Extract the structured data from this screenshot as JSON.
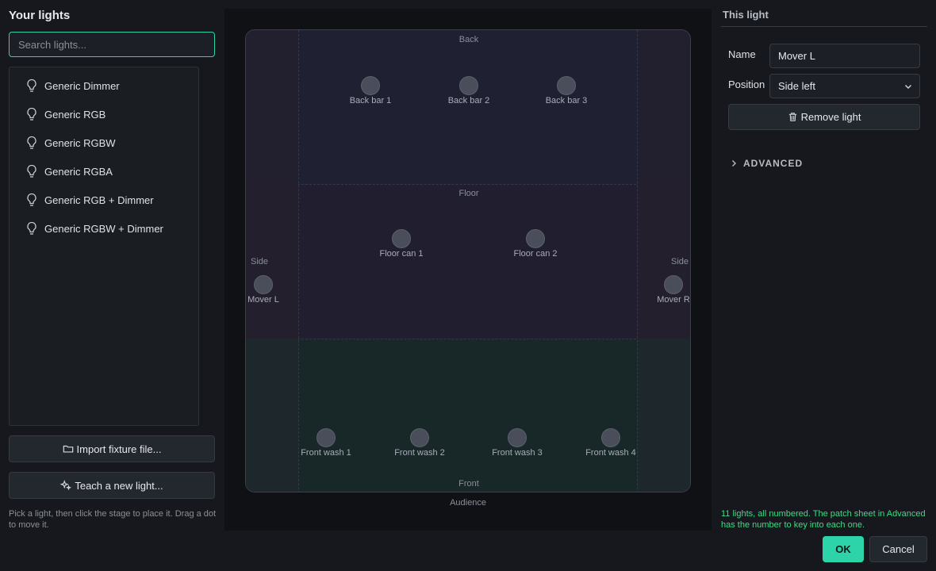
{
  "left": {
    "title": "Your lights",
    "search_placeholder": "Search lights...",
    "fixtures": [
      "Generic Dimmer",
      "Generic RGB",
      "Generic RGBW",
      "Generic RGBA",
      "Generic RGB + Dimmer",
      "Generic RGBW + Dimmer"
    ],
    "import_label": "Import fixture file...",
    "teach_label": "Teach a new light...",
    "hint": "Pick a light, then click the stage to place it. Drag a dot to move it."
  },
  "stage": {
    "zones": {
      "back": "Back",
      "floor": "Floor",
      "front": "Front",
      "side_left": "Side",
      "side_right": "Side"
    },
    "audience": "Audience",
    "lights": [
      {
        "id": "back-bar-1",
        "label": "Back bar 1"
      },
      {
        "id": "back-bar-2",
        "label": "Back bar 2"
      },
      {
        "id": "back-bar-3",
        "label": "Back bar 3"
      },
      {
        "id": "floor-can-1",
        "label": "Floor can 1"
      },
      {
        "id": "floor-can-2",
        "label": "Floor can 2"
      },
      {
        "id": "mover-l",
        "label": "Mover L"
      },
      {
        "id": "mover-r",
        "label": "Mover R"
      },
      {
        "id": "front-wash-1",
        "label": "Front wash 1"
      },
      {
        "id": "front-wash-2",
        "label": "Front wash 2"
      },
      {
        "id": "front-wash-3",
        "label": "Front wash 3"
      },
      {
        "id": "front-wash-4",
        "label": "Front wash 4"
      }
    ]
  },
  "right": {
    "title": "This light",
    "name_label": "Name",
    "name_value": "Mover L",
    "position_label": "Position",
    "position_value": "Side left",
    "remove_label": "Remove light",
    "advanced_label": "ADVANCED",
    "status": "11 lights, all numbered. The patch sheet in Advanced has the number to key into each one."
  },
  "footer": {
    "ok": "OK",
    "cancel": "Cancel"
  },
  "colors": {
    "accent": "#2dd4aa",
    "status": "#3ddc84"
  }
}
